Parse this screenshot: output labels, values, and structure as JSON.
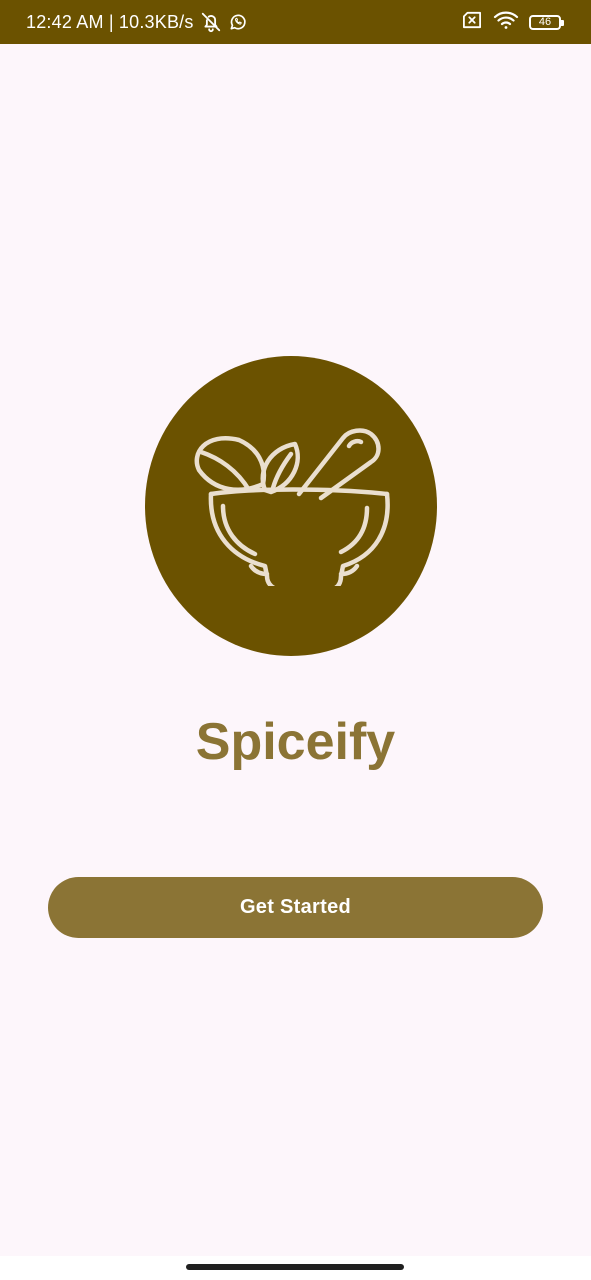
{
  "status_bar": {
    "time_and_speed": "12:42 AM | 10.3KB/s",
    "battery_level": "46",
    "icons": [
      "bell-off-icon",
      "whatsapp-icon",
      "sim-error-icon",
      "wifi-icon",
      "battery-icon"
    ]
  },
  "app": {
    "title": "Spiceify",
    "logo_icon": "mortar-pestle-icon"
  },
  "actions": {
    "get_started_label": "Get Started"
  },
  "colors": {
    "brand_dark": "#6b5200",
    "brand": "#8b7435",
    "background": "#fdf6fb",
    "logo_line": "#eadfcf"
  }
}
